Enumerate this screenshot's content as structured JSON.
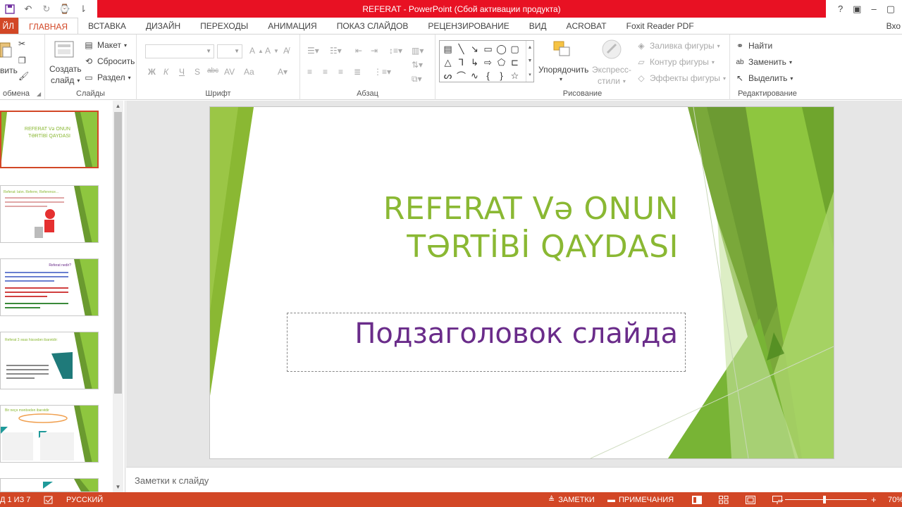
{
  "window": {
    "title": "REFERAT  -  PowerPoint (Сбой активации продукта)",
    "controls": [
      "?",
      "▣",
      "–",
      "▢"
    ]
  },
  "quick_access": [
    "save-icon",
    "undo-icon",
    "redo-icon",
    "present-icon",
    "customize-icon"
  ],
  "tabs": {
    "file": "ЙЛ",
    "items": [
      "ГЛАВНАЯ",
      "ВСТАВКА",
      "ДИЗАЙН",
      "ПЕРЕХОДЫ",
      "АНИМАЦИЯ",
      "ПОКАЗ СЛАЙДОВ",
      "РЕЦЕНЗИРОВАНИЕ",
      "ВИД",
      "ACROBAT",
      "Foxit Reader PDF"
    ],
    "active": "ГЛАВНАЯ",
    "signin": "Вхо"
  },
  "ribbon": {
    "clipboard": {
      "paste": "вить",
      "label": "обмена"
    },
    "slides": {
      "new_slide_line1": "Создать",
      "new_slide_line2": "слайд",
      "layout": "Макет",
      "reset": "Сбросить",
      "section": "Раздел",
      "label": "Слайды"
    },
    "font": {
      "label": "Шрифт",
      "bold": "Ж",
      "italic": "К",
      "underline": "Ч",
      "strike": "S",
      "abc": "abc",
      "aa": "Aa"
    },
    "paragraph": {
      "label": "Абзац"
    },
    "drawing": {
      "arrange": "Упорядочить",
      "quick_styles_1": "Экспресс-",
      "quick_styles_2": "стили",
      "fill": "Заливка фигуры",
      "outline": "Контур фигуры",
      "effects": "Эффекты фигуры",
      "label": "Рисование"
    },
    "editing": {
      "find": "Найти",
      "replace": "Заменить",
      "select": "Выделить",
      "label": "Редактирование"
    }
  },
  "thumbnails": [
    {
      "title": "REFERAT Və ONUN TƏRTİBİ QAYDASI",
      "selected": true
    },
    {
      "title": "Referat: latın. Referre, Reference...",
      "selected": false
    },
    {
      "title": "Referat nedir?",
      "selected": false
    },
    {
      "title": "Referat 3 əsas hissədən ibarətdir:",
      "selected": false
    },
    {
      "title": "Bir neçə mənbədən ibarətdir",
      "selected": false
    }
  ],
  "slide": {
    "title_line1": "REFERAT Və ONUN",
    "title_line2": "TƏRTİBİ QAYDASI",
    "subtitle": "Подзаголовок слайда"
  },
  "notes_placeholder": "Заметки к слайду",
  "statusbar": {
    "slide_counter": "Д 1 ИЗ 7",
    "language": "РУССКИЙ",
    "notes": "ЗАМЕТКИ",
    "comments": "ПРИМЕЧАНИЯ",
    "zoom": "70%"
  },
  "colors": {
    "accent": "#d24726",
    "title_green": "#8ab833",
    "subtitle_purple": "#6a2c8a",
    "titlebar_red": "#e81123"
  }
}
